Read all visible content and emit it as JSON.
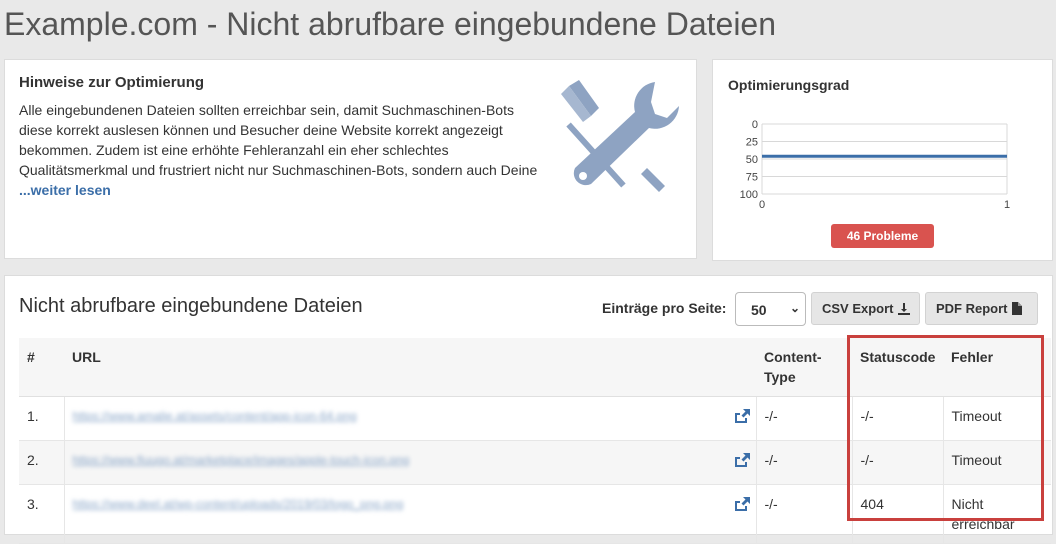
{
  "page": {
    "title": "Example.com - Nicht abrufbare eingebundene Dateien"
  },
  "hints": {
    "title": "Hinweise zur Optimierung",
    "text": "Alle eingebundenen Dateien sollten erreichbar sein, damit Suchmaschinen-Bots diese korrekt auslesen können und Besucher deine Website korrekt angezeigt bekommen. Zudem ist eine erhöhte Fehleranzahl ein eher schlechtes Qualitätsmerkmal und frustriert nicht nur Suchmaschinen-Bots, sondern auch Deine",
    "read_more": "...weiter lesen",
    "icon": "tools-icon"
  },
  "optimization": {
    "title": "Optimierungsgrad",
    "badge": "46 Probleme",
    "badge_color": "#d9534f"
  },
  "chart_data": {
    "type": "line",
    "title": "",
    "xlabel": "",
    "ylabel": "",
    "x_ticks": [
      "0",
      "1"
    ],
    "y_ticks": [
      "0",
      "25",
      "50",
      "75",
      "100"
    ],
    "xlim": [
      0,
      1
    ],
    "ylim": [
      100,
      0
    ],
    "y_inverted": true,
    "grid": true,
    "series": [
      {
        "x": [
          0,
          1
        ],
        "y": [
          46,
          46
        ],
        "color": "#3b6ea8"
      }
    ]
  },
  "list": {
    "title": "Nicht abrufbare eingebundene Dateien",
    "entries_label": "Einträge pro Seite:",
    "entries_value": "50",
    "csv_label": "CSV Export",
    "pdf_label": "PDF Report",
    "columns": {
      "num": "#",
      "url": "URL",
      "content_type": "Content-Type",
      "status": "Statuscode",
      "error": "Fehler"
    },
    "rows": [
      {
        "num": "1.",
        "url": "https://www.amalie.at/assets/content/app-icon-64.png",
        "content_type": "-/-",
        "status": "-/-",
        "error": "Timeout"
      },
      {
        "num": "2.",
        "url": "https://www.fiuugo.at/marketplace/images/apple-touch-icon.png",
        "content_type": "-/-",
        "status": "-/-",
        "error": "Timeout"
      },
      {
        "num": "3.",
        "url": "https://www.deel.at/wp-content/uploads/2019/03/logo_png.png",
        "content_type": "-/-",
        "status": "404",
        "error": "Nicht erreichbar"
      }
    ]
  },
  "colors": {
    "accent": "#3b6ea8",
    "danger": "#d9534f",
    "highlight": "#c9403d"
  }
}
